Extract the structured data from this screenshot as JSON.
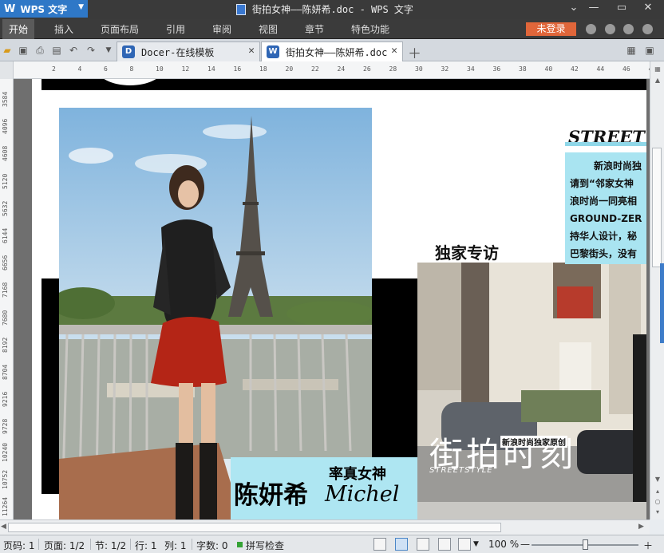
{
  "app": {
    "logo_text": "WPS 文字",
    "window_title": "街拍女神——陈妍希.doc - WPS 文字"
  },
  "menu": {
    "items": [
      "开始",
      "插入",
      "页面布局",
      "引用",
      "审阅",
      "视图",
      "章节",
      "特色功能"
    ],
    "login_label": "未登录"
  },
  "tabs": [
    {
      "label": "Docer-在线模板",
      "icon": "docer-icon"
    },
    {
      "label": "街拍女神——陈妍希.doc",
      "icon": "wps-doc-icon"
    }
  ],
  "ruler": {
    "horizontal": [
      "2",
      "4",
      "6",
      "8",
      "10",
      "12",
      "14",
      "16",
      "18",
      "20",
      "22",
      "24",
      "26",
      "28",
      "30",
      "32",
      "34",
      "36",
      "38",
      "40",
      "42",
      "44",
      "46",
      "48"
    ],
    "vertical": [
      "3584",
      "4096",
      "4608",
      "5120",
      "5632",
      "6144",
      "6656",
      "7168",
      "7680",
      "8192",
      "8704",
      "9216",
      "9728",
      "10240",
      "10752",
      "11264"
    ]
  },
  "document": {
    "street_title": "STREET S",
    "headline": "独家专访",
    "body_lines": [
      "新浪时尚独",
      "请到“邻家女神",
      "浪时尚一同亮相",
      "GROUND-ZER",
      "持华人设计，秘",
      "巴黎街头，没有"
    ],
    "name_small": "率真女神",
    "name_big": "陈妍希",
    "name_script": "Michel",
    "feature_big": "街拍时刻",
    "feature_tag": "新浪时尚独家原创",
    "feature_style": "STREETSTYLE"
  },
  "status": {
    "page_code": "页码: 1",
    "page": "页面: 1/2",
    "section": "节: 1/2",
    "row": "行: 1",
    "col": "列: 1",
    "words": "字数: 0",
    "spell": "拼写检查",
    "zoom": "100 %"
  },
  "colors": {
    "accent_blue": "#2f78c7",
    "login_orange": "#e0663a",
    "caption_cyan": "#aee6f2"
  }
}
